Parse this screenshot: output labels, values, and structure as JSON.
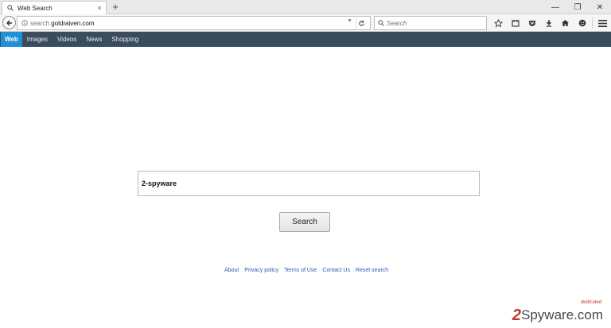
{
  "browser": {
    "tab": {
      "title": "Web Search",
      "close": "×"
    },
    "new_tab": "+",
    "window_controls": {
      "minimize": "—",
      "restore": "❐",
      "close": "✕"
    },
    "url": {
      "prefix": "search.",
      "domain": "goldraiven.com"
    },
    "search_placeholder": "Search"
  },
  "site_nav": {
    "items": [
      {
        "label": "Web",
        "active": true
      },
      {
        "label": "Images",
        "active": false
      },
      {
        "label": "Videos",
        "active": false
      },
      {
        "label": "News",
        "active": false
      },
      {
        "label": "Shopping",
        "active": false
      }
    ]
  },
  "main": {
    "query_value": "2-spyware",
    "search_button": "Search"
  },
  "footer": {
    "links": [
      "About",
      "Privacy policy",
      "Terms of Use",
      "Contact Us",
      "Reset search"
    ]
  },
  "watermark": {
    "mark": "2",
    "text": "Spyware.com",
    "badge": "dedicated"
  },
  "colors": {
    "nav_bg": "#3a4d5f",
    "nav_active": "#1e90d6",
    "link": "#2a5db0"
  }
}
